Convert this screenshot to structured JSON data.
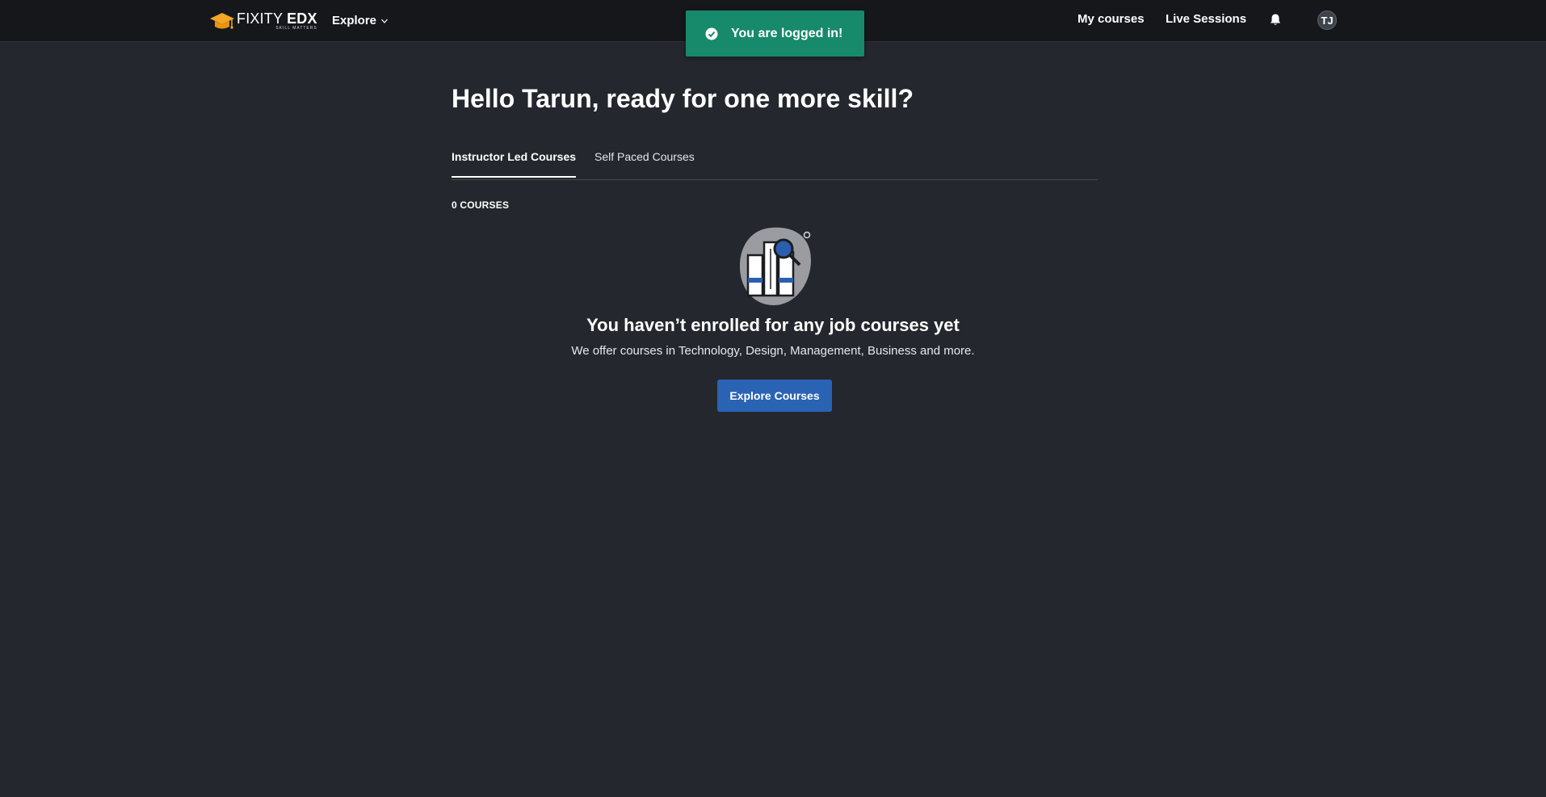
{
  "header": {
    "logo": {
      "thin": "FIXITY ",
      "bold": "EDX",
      "tagline": "SKILL MATTERS"
    },
    "explore_label": "Explore",
    "my_courses_label": "My courses",
    "live_sessions_label": "Live Sessions",
    "avatar_initials": "TJ"
  },
  "toast": {
    "message": "You are logged in!",
    "color": "#178a6b"
  },
  "main": {
    "greeting": "Hello Tarun, ready for one more skill?",
    "tabs": [
      {
        "label": "Instructor Led Courses",
        "active": true
      },
      {
        "label": "Self Paced Courses",
        "active": false
      }
    ],
    "course_count": "0 COURSES",
    "empty_state": {
      "title": "You haven’t enrolled for any job courses yet",
      "subtitle": "We offer courses in Technology, Design, Management, Business and more.",
      "button_label": "Explore Courses"
    }
  },
  "colors": {
    "background": "#24272d",
    "topbar": "#15171b",
    "accent": "#2a63b3",
    "logo_cap": "#f5a623"
  }
}
